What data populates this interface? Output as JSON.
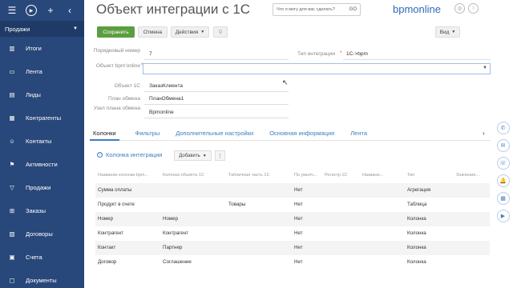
{
  "sidebar": {
    "workspace": "Продажи",
    "items": [
      {
        "label": "Итоги",
        "icon": "bar-chart-icon"
      },
      {
        "label": "Лента",
        "icon": "chat-icon"
      },
      {
        "label": "Лиды",
        "icon": "book-icon"
      },
      {
        "label": "Контрагенты",
        "icon": "building-icon"
      },
      {
        "label": "Контакты",
        "icon": "person-icon"
      },
      {
        "label": "Активности",
        "icon": "flag-icon"
      },
      {
        "label": "Продажи",
        "icon": "funnel-icon"
      },
      {
        "label": "Заказы",
        "icon": "cart-icon"
      },
      {
        "label": "Договоры",
        "icon": "contract-icon"
      },
      {
        "label": "Счета",
        "icon": "invoice-icon"
      },
      {
        "label": "Документы",
        "icon": "document-icon"
      }
    ]
  },
  "header": {
    "title": "Объект интеграции с 1С",
    "help_placeholder": "Что я могу для вас сделать?",
    "help_go": "GO",
    "logo": "bpmonline"
  },
  "toolbar": {
    "save_label": "Сохранить",
    "cancel_label": "Отмена",
    "actions_label": "Действия",
    "view_label": "Вид"
  },
  "fields": {
    "order_number_label": "Порядковый номер",
    "order_number_value": "7",
    "integration_type_label": "Тип интеграции",
    "integration_type_value": "1С->bpm",
    "bpm_object_label": "Объект bpm'online",
    "bpm_object_value": "",
    "obj1c_label": "Объект 1С",
    "obj1c_value": "ЗаказКлиента",
    "exchange_plan_label": "План обмена",
    "exchange_plan_value": "ПланОбмена1",
    "exchange_node_label": "Узел плана обмена",
    "exchange_node_value": "Bpmonline"
  },
  "tabs": [
    "Колонки",
    "Фильтры",
    "Дополнительные настройки",
    "Основная информация",
    "Лента"
  ],
  "detail": {
    "title": "Колонка интеграции",
    "add_label": "Добавить",
    "columns": [
      "Название колонки bpm...",
      "Колонка объекта 1С",
      "Табличная часть 1С",
      "По умолч...",
      "Регистр 1С",
      "Названи...",
      "Тип",
      "Значение..."
    ],
    "rows": [
      [
        "Сумма оплаты",
        "",
        "",
        "Нет",
        "",
        "",
        "Агрегация",
        ""
      ],
      [
        "Продукт в счете",
        "",
        "Товары",
        "Нет",
        "",
        "",
        "Таблица",
        ""
      ],
      [
        "Номер",
        "Номер",
        "",
        "Нет",
        "",
        "",
        "Колонка",
        ""
      ],
      [
        "Контрагент",
        "Контрагент",
        "",
        "Нет",
        "",
        "",
        "Колонка",
        ""
      ],
      [
        "Контакт",
        "Партнер",
        "",
        "Нет",
        "",
        "",
        "Колонка",
        ""
      ],
      [
        "Договор",
        "Соглашение",
        "",
        "Нет",
        "",
        "",
        "Колонка",
        ""
      ]
    ]
  },
  "colors": {
    "sidebar_bg": "#28477a",
    "save_button": "#5a9e3e",
    "link": "#3a7fc3"
  }
}
